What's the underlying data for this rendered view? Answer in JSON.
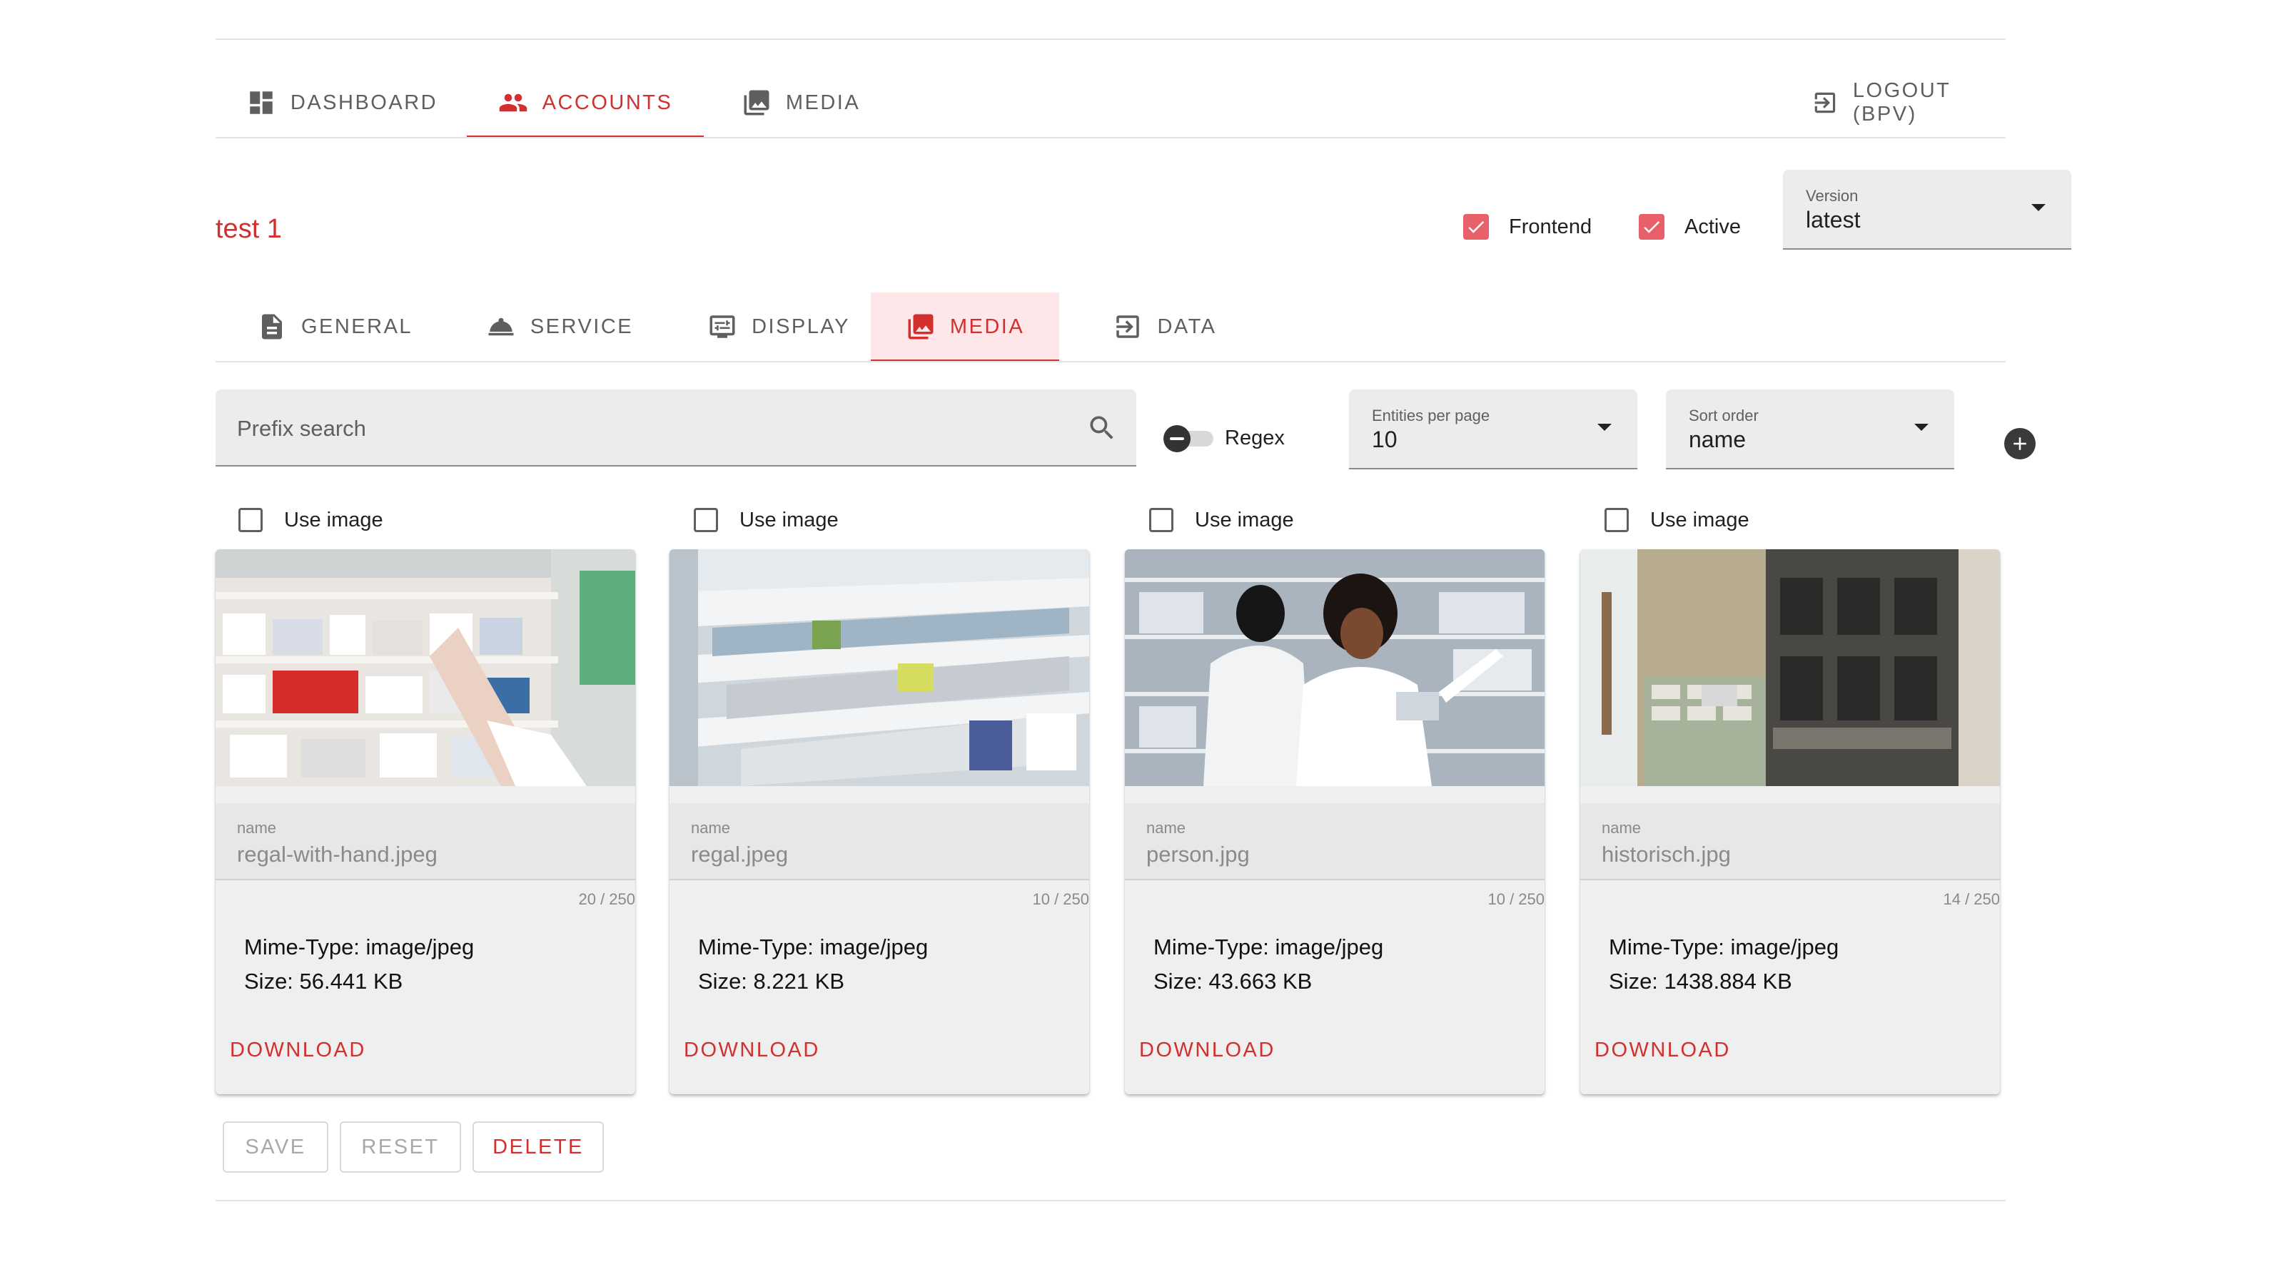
{
  "topnav": {
    "tabs": [
      {
        "label": "DASHBOARD",
        "icon": "dashboard-icon"
      },
      {
        "label": "ACCOUNTS",
        "icon": "people-icon",
        "active": true
      },
      {
        "label": "MEDIA",
        "icon": "photo-library-icon"
      }
    ],
    "logout_label": "LOGOUT (BPV)"
  },
  "account": {
    "title": "test 1",
    "frontend_label": "Frontend",
    "frontend_checked": true,
    "active_label": "Active",
    "active_checked": true,
    "version": {
      "label": "Version",
      "value": "latest"
    }
  },
  "subtabs": [
    {
      "label": "GENERAL",
      "icon": "description-icon"
    },
    {
      "label": "SERVICE",
      "icon": "room-service-icon"
    },
    {
      "label": "DISPLAY",
      "icon": "display-settings-icon"
    },
    {
      "label": "MEDIA",
      "icon": "photo-library-icon",
      "active": true
    },
    {
      "label": "DATA",
      "icon": "input-icon"
    }
  ],
  "toolbar": {
    "search_placeholder": "Prefix search",
    "regex_label": "Regex",
    "entities": {
      "label": "Entities per page",
      "value": "10"
    },
    "sort": {
      "label": "Sort order",
      "value": "name"
    }
  },
  "media_items": [
    {
      "use_image_label": "Use image",
      "name_label": "name",
      "name": "regal-with-hand.jpeg",
      "counter": "20 / 250",
      "mime": "Mime-Type: image/jpeg",
      "size": "Size: 56.441 KB",
      "download_label": "DOWNLOAD"
    },
    {
      "use_image_label": "Use image",
      "name_label": "name",
      "name": "regal.jpeg",
      "counter": "10 / 250",
      "mime": "Mime-Type: image/jpeg",
      "size": "Size: 8.221 KB",
      "download_label": "DOWNLOAD"
    },
    {
      "use_image_label": "Use image",
      "name_label": "name",
      "name": "person.jpg",
      "counter": "10 / 250",
      "mime": "Mime-Type: image/jpeg",
      "size": "Size: 43.663 KB",
      "download_label": "DOWNLOAD"
    },
    {
      "use_image_label": "Use image",
      "name_label": "name",
      "name": "historisch.jpg",
      "counter": "14 / 250",
      "mime": "Mime-Type: image/jpeg",
      "size": "Size: 1438.884 KB",
      "download_label": "DOWNLOAD"
    }
  ],
  "actions": {
    "save_label": "SAVE",
    "reset_label": "RESET",
    "delete_label": "DELETE"
  },
  "colors": {
    "accent": "#d32f2f",
    "checkbox": "#e8606a",
    "active_tab_bg": "#fde7e9"
  }
}
